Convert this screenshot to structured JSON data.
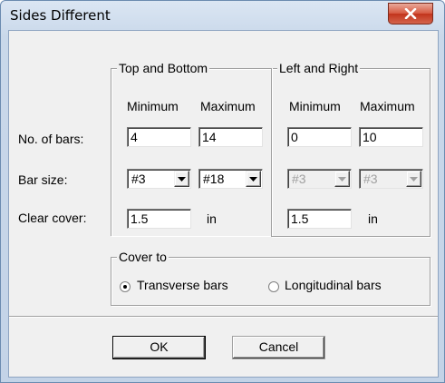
{
  "window": {
    "title": "Sides Different"
  },
  "groups": {
    "top_bottom": "Top and Bottom",
    "left_right": "Left and Right",
    "cover_to": "Cover to"
  },
  "columns": {
    "minimum": "Minimum",
    "maximum": "Maximum"
  },
  "rows": {
    "no_of_bars": "No. of bars:",
    "bar_size": "Bar size:",
    "clear_cover": "Clear cover:"
  },
  "top_bottom": {
    "min_bars": "4",
    "max_bars": "14",
    "min_size": "#3",
    "max_size": "#18",
    "clear_cover": "1.5",
    "unit": "in"
  },
  "left_right": {
    "min_bars": "0",
    "max_bars": "10",
    "min_size": "#3",
    "max_size": "#3",
    "clear_cover": "1.5",
    "unit": "in"
  },
  "cover_to": {
    "options": [
      "Transverse bars",
      "Longitudinal bars"
    ],
    "selected": "Transverse bars"
  },
  "buttons": {
    "ok": "OK",
    "cancel": "Cancel"
  },
  "icons": {
    "close": "close-icon",
    "dropdown": "chevron-down-icon"
  },
  "colors": {
    "close_button": "#c2341c",
    "disabled_text": "#a0a0a0"
  }
}
